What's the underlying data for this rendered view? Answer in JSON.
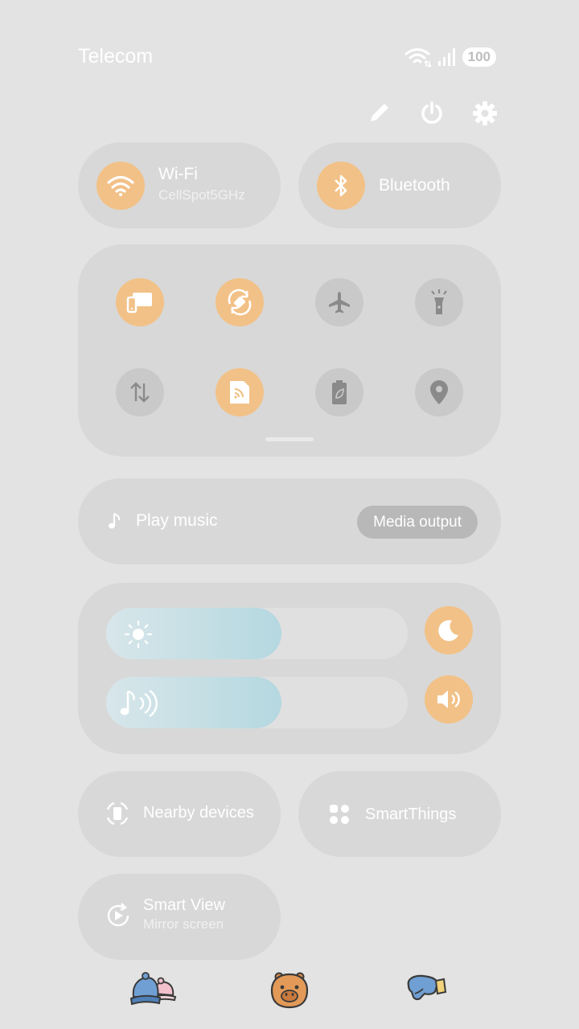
{
  "status_bar": {
    "carrier": "Telecom",
    "battery": "100",
    "icons": [
      "wifi-icon",
      "signal-icon",
      "battery-icon"
    ]
  },
  "top_actions": [
    "edit-icon",
    "power-icon",
    "settings-icon"
  ],
  "wifi": {
    "title": "Wi-Fi",
    "subtitle": "CellSpot5GHz",
    "active": true
  },
  "bluetooth": {
    "title": "Bluetooth",
    "active": true
  },
  "toggles": [
    {
      "name": "screen-mirroring",
      "icon": "devices-icon",
      "active": true
    },
    {
      "name": "auto-rotate",
      "icon": "rotate-icon",
      "active": true
    },
    {
      "name": "airplane-mode",
      "icon": "airplane-icon",
      "active": false
    },
    {
      "name": "flashlight",
      "icon": "flashlight-icon",
      "active": false
    },
    {
      "name": "mobile-data",
      "icon": "data-arrows-icon",
      "active": false
    },
    {
      "name": "cast",
      "icon": "cast-icon",
      "active": true
    },
    {
      "name": "power-saving",
      "icon": "battery-leaf-icon",
      "active": false
    },
    {
      "name": "location",
      "icon": "location-pin-icon",
      "active": false
    }
  ],
  "media": {
    "label": "Play music",
    "output_button": "Media output"
  },
  "sliders": {
    "brightness": {
      "level": 0.58,
      "icon": "sun-icon",
      "side_icon": "moon-icon"
    },
    "volume": {
      "level": 0.58,
      "icon": "music-note-icon",
      "side_icon": "speaker-icon"
    }
  },
  "shortcuts": {
    "nearby": "Nearby devices",
    "smartthings": "SmartThings",
    "smartview_title": "Smart View",
    "smartview_sub": "Mirror screen"
  },
  "dock": [
    "hats-icon",
    "capybara-icon",
    "mitten-icon"
  ],
  "colors": {
    "background": "#e3e3e3",
    "tile": "#d8d8d8",
    "accent": "#f2c187",
    "inactive": "#c9c9c9",
    "slider_fill": "#b5d8e0"
  }
}
